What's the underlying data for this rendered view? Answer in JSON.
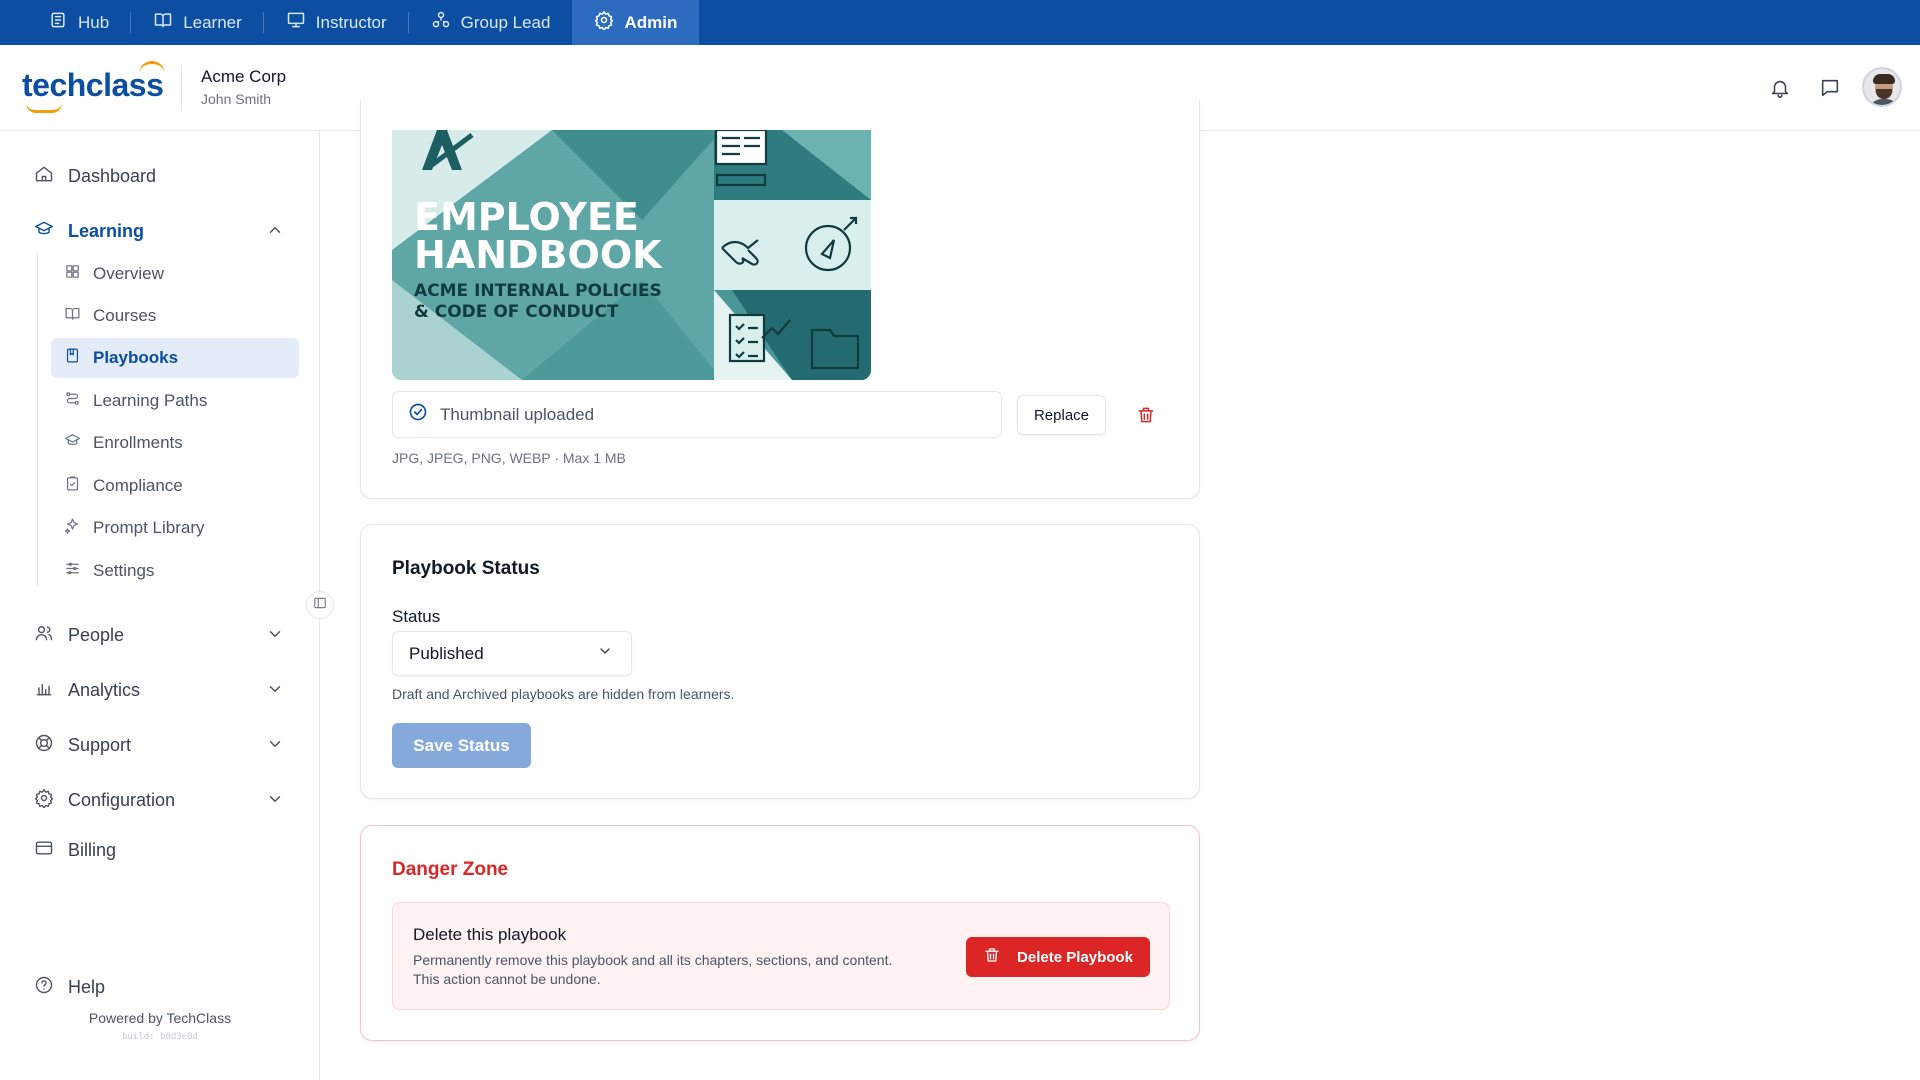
{
  "roles": [
    {
      "label": "Hub",
      "icon": "hub-icon",
      "active": false
    },
    {
      "label": "Learner",
      "icon": "book-open-icon",
      "active": false
    },
    {
      "label": "Instructor",
      "icon": "presentation-icon",
      "active": false
    },
    {
      "label": "Group Lead",
      "icon": "group-icon",
      "active": false
    },
    {
      "label": "Admin",
      "icon": "gear-icon",
      "active": true
    }
  ],
  "header": {
    "logo_text": "techclass",
    "org_name": "Acme Corp",
    "user_name": "John Smith"
  },
  "sidebar": {
    "dashboard": "Dashboard",
    "learning": "Learning",
    "learning_items": [
      {
        "label": "Overview",
        "active": false
      },
      {
        "label": "Courses",
        "active": false
      },
      {
        "label": "Playbooks",
        "active": true
      },
      {
        "label": "Learning Paths",
        "active": false
      },
      {
        "label": "Enrollments",
        "active": false
      },
      {
        "label": "Compliance",
        "active": false
      },
      {
        "label": "Prompt Library",
        "active": false
      },
      {
        "label": "Settings",
        "active": false
      }
    ],
    "people": "People",
    "analytics": "Analytics",
    "support": "Support",
    "configuration": "Configuration",
    "billing": "Billing",
    "help": "Help",
    "powered_by": "Powered by TechClass",
    "build": "build: b0d3e8d"
  },
  "thumbnail": {
    "image_text": {
      "title_line1": "EMPLOYEE",
      "title_line2": "HANDBOOK",
      "subtitle_line1": "ACME INTERNAL POLICIES",
      "subtitle_line2": "& CODE OF CONDUCT"
    },
    "status": "Thumbnail uploaded",
    "replace_label": "Replace",
    "formats": "JPG, JPEG, PNG, WEBP · Max 1 MB"
  },
  "status_card": {
    "title": "Playbook Status",
    "field_label": "Status",
    "selected": "Published",
    "help": "Draft and Archived playbooks are hidden from learners.",
    "save_label": "Save Status"
  },
  "danger": {
    "title": "Danger Zone",
    "heading": "Delete this playbook",
    "desc_line1": "Permanently remove this playbook and all its chapters, sections, and content.",
    "desc_line2": "This action cannot be undone.",
    "button_label": "Delete Playbook"
  },
  "colors": {
    "brand": "#0b4ea2",
    "danger": "#dc2626",
    "thumbnail_teal": "#5ea7a6"
  }
}
